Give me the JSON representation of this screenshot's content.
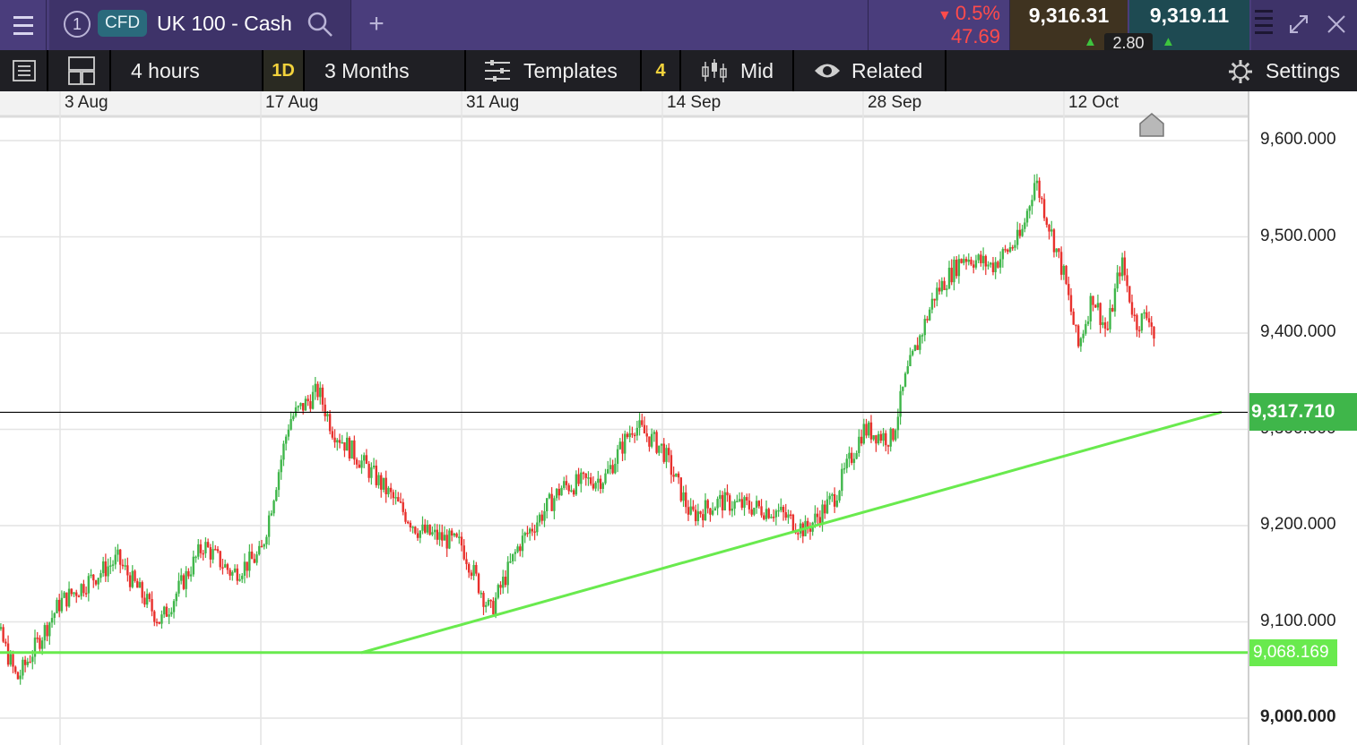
{
  "header": {
    "tab_number": "1",
    "instrument_type": "CFD",
    "instrument_name": "UK 100 - Cash",
    "add_tab": "+",
    "change_pct": "0.5%",
    "change_abs": "47.69",
    "sell_price": "9,316.31",
    "buy_price": "9,319.11",
    "spread": "2.80",
    "colors": {
      "header_bg": "#4a3d7c",
      "down": "#ff4b4b",
      "up": "#3ec43e"
    }
  },
  "toolbar": {
    "interval": "4 hours",
    "interval_short": "1D",
    "range": "3 Months",
    "templates": "Templates",
    "templates_count": "4",
    "price_type": "Mid",
    "related": "Related",
    "settings": "Settings"
  },
  "chart_data": {
    "type": "candlestick",
    "x_tick_labels": [
      "3 Aug",
      "17 Aug",
      "31 Aug",
      "14 Sep",
      "28 Sep",
      "12 Oct"
    ],
    "y_tick_labels": [
      "9,600.000",
      "9,500.000",
      "9,400.000",
      "9,300.000",
      "9,200.000",
      "9,100.000",
      "9,000.000"
    ],
    "ylim": [
      8975,
      9640
    ],
    "current_price": "9,317.710",
    "horizontal_level": "9,068.169",
    "colors": {
      "up": "#3fb64a",
      "down": "#e8302c",
      "trendline": "#69ea4e",
      "price_line": "#000000"
    },
    "anchor_points": [
      {
        "date": "28 Jul",
        "price": 9140
      },
      {
        "date": "30 Jul",
        "price": 9080
      },
      {
        "date": "31 Jul",
        "price": 9040
      },
      {
        "date": "3 Aug",
        "price": 9120
      },
      {
        "date": "7 Aug",
        "price": 9165
      },
      {
        "date": "10 Aug",
        "price": 9100
      },
      {
        "date": "13 Aug",
        "price": 9180
      },
      {
        "date": "15 Aug",
        "price": 9150
      },
      {
        "date": "17 Aug",
        "price": 9170
      },
      {
        "date": "19 Aug",
        "price": 9310
      },
      {
        "date": "21 Aug",
        "price": 9340
      },
      {
        "date": "22 Aug",
        "price": 9300
      },
      {
        "date": "25 Aug",
        "price": 9250
      },
      {
        "date": "28 Aug",
        "price": 9195
      },
      {
        "date": "31 Aug",
        "price": 9180
      },
      {
        "date": "2 Sep",
        "price": 9110
      },
      {
        "date": "4 Sep",
        "price": 9180
      },
      {
        "date": "7 Sep",
        "price": 9240
      },
      {
        "date": "10 Sep",
        "price": 9250
      },
      {
        "date": "12 Sep",
        "price": 9305
      },
      {
        "date": "14 Sep",
        "price": 9280
      },
      {
        "date": "16 Sep",
        "price": 9210
      },
      {
        "date": "18 Sep",
        "price": 9225
      },
      {
        "date": "22 Sep",
        "price": 9215
      },
      {
        "date": "24 Sep",
        "price": 9195
      },
      {
        "date": "26 Sep",
        "price": 9230
      },
      {
        "date": "28 Sep",
        "price": 9300
      },
      {
        "date": "30 Sep",
        "price": 9290
      },
      {
        "date": "1 Oct",
        "price": 9355
      },
      {
        "date": "3 Oct",
        "price": 9440
      },
      {
        "date": "5 Oct",
        "price": 9480
      },
      {
        "date": "7 Oct",
        "price": 9470
      },
      {
        "date": "9 Oct",
        "price": 9500
      },
      {
        "date": "10 Oct",
        "price": 9560
      },
      {
        "date": "12 Oct",
        "price": 9460
      },
      {
        "date": "13 Oct",
        "price": 9385
      },
      {
        "date": "14 Oct",
        "price": 9440
      },
      {
        "date": "15 Oct",
        "price": 9400
      },
      {
        "date": "16 Oct",
        "price": 9475
      },
      {
        "date": "17 Oct",
        "price": 9410
      },
      {
        "date": "18 Oct",
        "price": 9420
      },
      {
        "date": "19 Oct",
        "price": 9330
      },
      {
        "date": "20 Oct",
        "price": 9318
      }
    ],
    "trendline": [
      {
        "date": "24 Aug",
        "price": 9068
      },
      {
        "date": "23 Oct",
        "price": 9318
      }
    ]
  }
}
